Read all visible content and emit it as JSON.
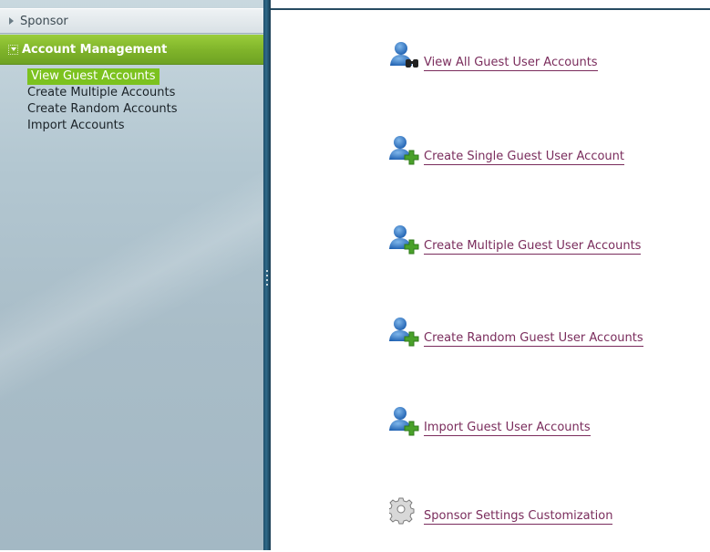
{
  "sidebar": {
    "sponsor_label": "Sponsor",
    "account_management_label": "Account Management",
    "items": [
      {
        "label": "View Guest Accounts",
        "active": true
      },
      {
        "label": "Create Multiple Accounts",
        "active": false
      },
      {
        "label": "Create Random Accounts",
        "active": false
      },
      {
        "label": "Import Accounts",
        "active": false
      }
    ]
  },
  "main": {
    "links": [
      {
        "label": "View All Guest User Accounts",
        "icon": "user-binoculars-icon"
      },
      {
        "label": "Create Single Guest User Account",
        "icon": "user-add-icon"
      },
      {
        "label": "Create Multiple Guest User Accounts",
        "icon": "user-add-icon"
      },
      {
        "label": "Create Random Guest User Accounts",
        "icon": "user-add-icon"
      },
      {
        "label": "Import Guest User Accounts",
        "icon": "user-add-icon"
      },
      {
        "label": "Sponsor Settings Customization",
        "icon": "gear-icon"
      }
    ]
  },
  "colors": {
    "accent_green": "#7cc21f",
    "link": "#7a2c5c",
    "sidebar_bg": "#b3c7d1",
    "splitter": "#1f4e6a"
  }
}
